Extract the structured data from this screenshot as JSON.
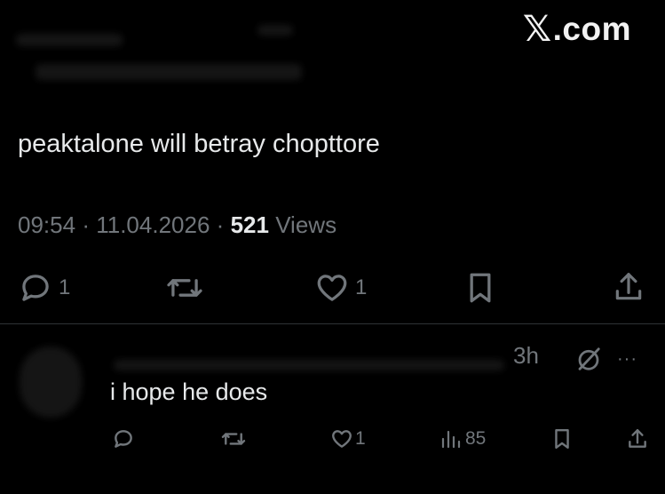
{
  "watermark": {
    "text": ".com"
  },
  "tweet": {
    "text": "peaktalone will betray chopttore",
    "time": "09:54",
    "date": "11.04.2026",
    "separator": "·",
    "views_count": "521",
    "views_label": "Views",
    "actions": {
      "reply_count": "1",
      "retweet_count": "",
      "like_count": "1"
    }
  },
  "reply": {
    "time": "3h",
    "more": "···",
    "text": "i hope he does",
    "actions": {
      "reply_count": "",
      "retweet_count": "",
      "like_count": "1",
      "views_count": "85"
    }
  },
  "icons": {
    "reply": "reply-bubble-icon",
    "retweet": "retweet-icon",
    "like": "heart-icon",
    "bookmark": "bookmark-icon",
    "share": "share-icon",
    "views": "views-bar-chart-icon",
    "grok": "grok-icon",
    "more": "more-dots-icon"
  },
  "colors": {
    "background": "#000000",
    "text_primary": "#e7e9ea",
    "text_secondary": "#71767b",
    "divider": "#2f3336"
  }
}
